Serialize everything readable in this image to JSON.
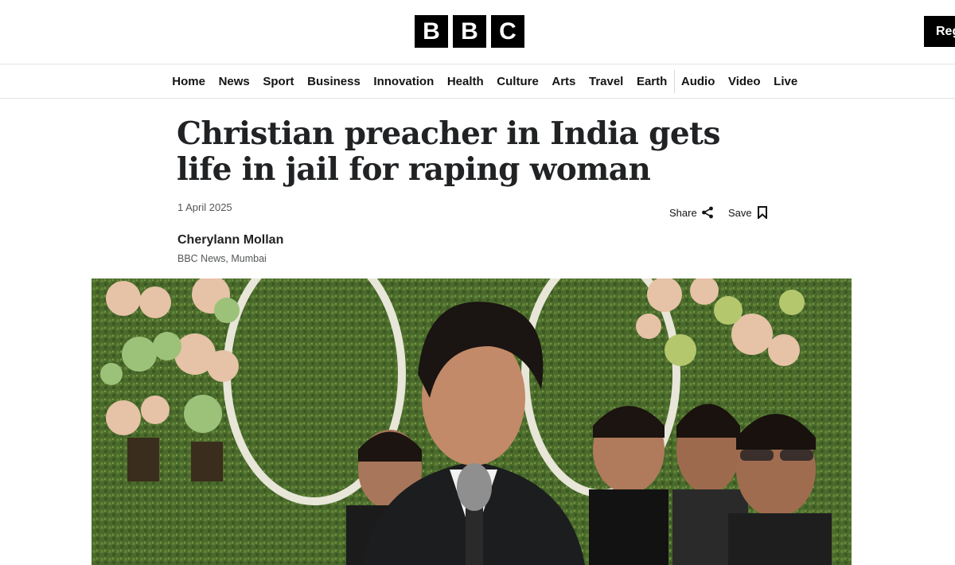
{
  "masthead": {
    "logo_letters": [
      "B",
      "B",
      "C"
    ],
    "register_label": "Reg"
  },
  "nav": {
    "items": [
      "Home",
      "News",
      "Sport",
      "Business",
      "Innovation",
      "Health",
      "Culture",
      "Arts",
      "Travel",
      "Earth",
      "Audio",
      "Video",
      "Live"
    ]
  },
  "article": {
    "headline": "Christian preacher in India gets life in jail for raping woman",
    "date": "1 April 2025",
    "share_label": "Share",
    "save_label": "Save",
    "author": "Cherylann Mollan",
    "author_role": "BBC News, Mumbai"
  },
  "colors": {
    "logo_bg": "#000000",
    "text": "#202224",
    "meta": "#545658"
  },
  "icons": [
    "share-icon",
    "bookmark-icon"
  ]
}
